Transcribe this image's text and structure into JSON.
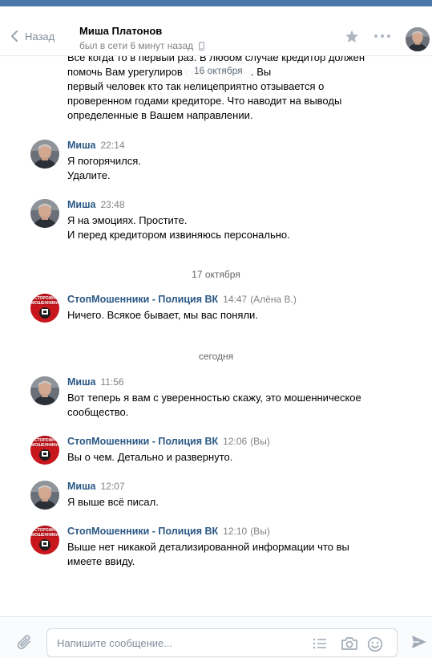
{
  "header": {
    "back_label": "Назад",
    "peer_name": "Миша Платонов",
    "peer_status": "был в сети 6 минут назад"
  },
  "chat": {
    "floating_date": "16 октября",
    "continued_lines": [
      "Все когда то в первый раз. В любом случае кредитор должен",
      "помочь Вам урегулиров                    ские вопросы. Вы",
      "первый человек кто так нелицеприятно отзывается о",
      "проверенном годами кредиторе. Что наводит на выводы",
      "определенные в Вашем направлении."
    ],
    "messages": [
      {
        "author": "Миша",
        "time": "22:14",
        "extra": "",
        "lines": [
          "Я погорячился.",
          "Удалите."
        ]
      },
      {
        "author": "Миша",
        "time": "23:48",
        "extra": "",
        "lines": [
          "Я на эмоциях. Простите.",
          "И перед кредитором извиняюсь персонально."
        ]
      },
      {
        "author": "СтопМошенники - Полиция ВК",
        "time": "14:47",
        "extra": "(Алёна В.)",
        "lines": [
          "Ничего. Всякое бывает, мы вас поняли."
        ]
      },
      {
        "author": "Миша",
        "time": "11:56",
        "extra": "",
        "lines": [
          "Вот теперь я вам с уверенностью скажу, это мошенническое",
          "сообщество."
        ]
      },
      {
        "author": "СтопМошенники - Полиция ВК",
        "time": "12:06",
        "extra": "(Вы)",
        "lines": [
          "Вы о чем. Детально и развернуто."
        ]
      },
      {
        "author": "Миша",
        "time": "12:07",
        "extra": "",
        "lines": [
          "Я выше всё писал."
        ]
      },
      {
        "author": "СтопМошенники - Полиция ВК",
        "time": "12:10",
        "extra": "(Вы)",
        "lines": [
          "Выше нет никакой детализированной информации что вы",
          "имеете ввиду."
        ]
      }
    ],
    "day_separators": [
      "17 октября",
      "сегодня"
    ],
    "community_logo_text": [
      "ОСТОРОЖНО",
      "МОШЕННИКИ"
    ]
  },
  "composer": {
    "placeholder": "Напишите сообщение..."
  },
  "colors": {
    "topbar": "#4a76a8",
    "author": "#2a5885",
    "muted": "#828282",
    "logo_red": "#c8161d"
  },
  "icons": [
    "chevron-left-icon",
    "phone-icon",
    "star-icon",
    "more-icon",
    "paperclip-icon",
    "template-icon",
    "camera-icon",
    "smile-icon",
    "send-icon"
  ]
}
